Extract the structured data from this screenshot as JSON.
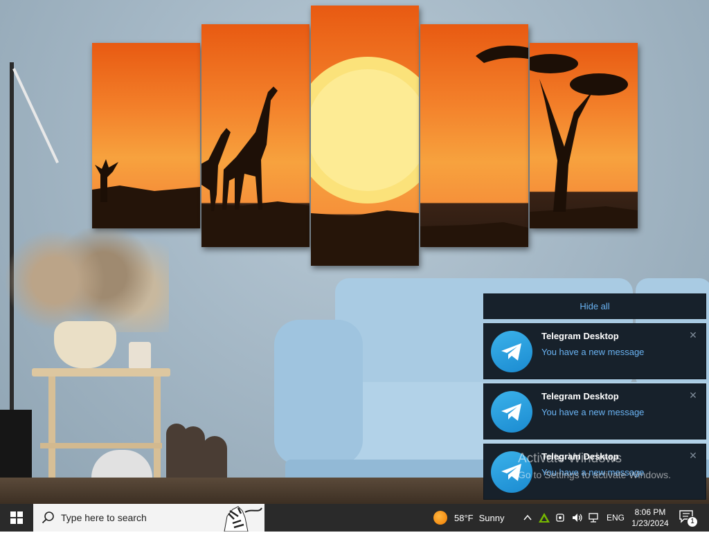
{
  "notifications": {
    "hide_all_label": "Hide all",
    "items": [
      {
        "app": "Telegram Desktop",
        "message": "You have a new message",
        "close": "✕"
      },
      {
        "app": "Telegram Desktop",
        "message": "You have a new message",
        "close": "✕"
      },
      {
        "app": "Telegram Desktop",
        "message": "You have a new message",
        "close": "✕"
      }
    ],
    "icon": "telegram-icon",
    "colors": {
      "bg": "#17212b",
      "accent": "#6ab3f3",
      "title": "#ffffff"
    }
  },
  "watermark": {
    "title": "Activate Windows",
    "subtitle": "Go to Settings to activate Windows."
  },
  "taskbar": {
    "start_icon": "windows-logo-icon",
    "search_placeholder": "Type here to search",
    "weather": {
      "temp": "58°F",
      "condition": "Sunny",
      "icon": "sun-icon"
    },
    "tray": {
      "icons": [
        "chevron-up-icon",
        "nvidia-icon",
        "meet-now-icon",
        "volume-icon",
        "network-icon"
      ],
      "language": "ENG"
    },
    "clock": {
      "time": "8:06 PM",
      "date": "1/23/2024"
    },
    "notifications_count": "1",
    "bg": "#2a2a2a"
  }
}
